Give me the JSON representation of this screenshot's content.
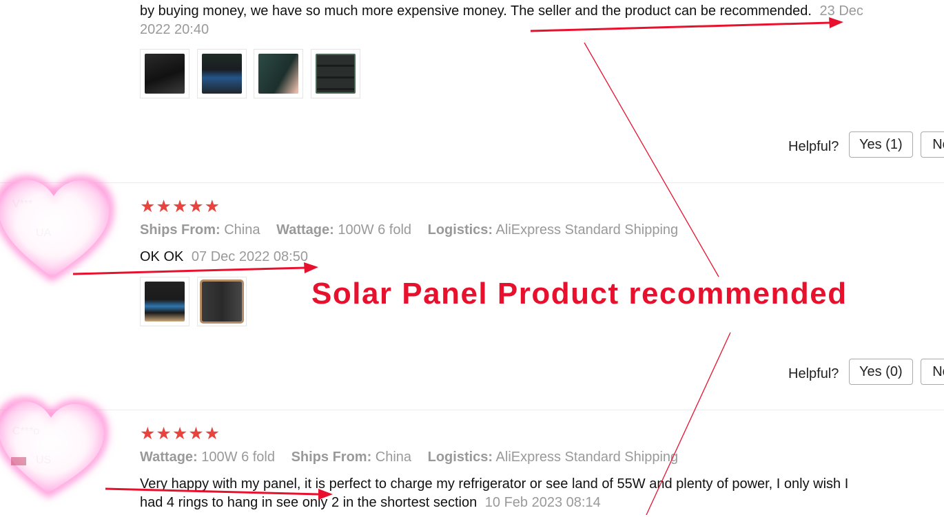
{
  "reviews": [
    {
      "text": "by buying money, we have so much more expensive money. The seller and the product can be recommended.",
      "date_part1": "23 Dec",
      "date_part2": "2022 20:40",
      "helpful_label": "Helpful?",
      "yes_label": "Yes (1)",
      "no_label": "No"
    },
    {
      "avatar_name": "V***",
      "avatar_country": "UA",
      "stars": "★★★★★",
      "meta": [
        {
          "label": "Ships From:",
          "value": "China"
        },
        {
          "label": "Wattage:",
          "value": "100W 6 fold"
        },
        {
          "label": "Logistics:",
          "value": "AliExpress Standard Shipping"
        }
      ],
      "text": "OK OK",
      "date": "07 Dec 2022 08:50",
      "helpful_label": "Helpful?",
      "yes_label": "Yes (0)",
      "no_label": "No"
    },
    {
      "avatar_name": "C***o",
      "avatar_country": "US",
      "stars": "★★★★★",
      "meta": [
        {
          "label": "Wattage:",
          "value": "100W 6 fold"
        },
        {
          "label": "Ships From:",
          "value": "China"
        },
        {
          "label": "Logistics:",
          "value": "AliExpress Standard Shipping"
        }
      ],
      "text_line1": "Very happy with my panel, it is perfect to charge my refrigerator or see land of 55W and plenty of power, I only wish I",
      "text_line2": "had 4 rings to hang in see only 2 in the shortest section",
      "date": "10 Feb 2023 08:14"
    }
  ],
  "overlay_title": "Solar Panel Product recommended",
  "colors": {
    "accent_red": "#e8112d",
    "star_red": "#e8443d",
    "muted_text": "#999999",
    "heart_pink": "#ff8fd6"
  }
}
